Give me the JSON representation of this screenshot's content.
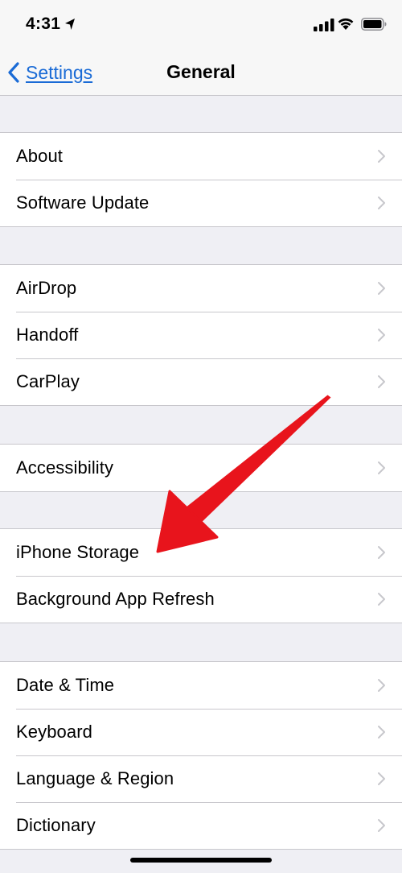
{
  "status_bar": {
    "time": "4:31"
  },
  "nav": {
    "back_label": "Settings",
    "title": "General"
  },
  "groups": [
    {
      "items": [
        "About",
        "Software Update"
      ]
    },
    {
      "items": [
        "AirDrop",
        "Handoff",
        "CarPlay"
      ]
    },
    {
      "items": [
        "Accessibility"
      ]
    },
    {
      "items": [
        "iPhone Storage",
        "Background App Refresh"
      ]
    },
    {
      "items": [
        "Date & Time",
        "Keyboard",
        "Language & Region",
        "Dictionary"
      ]
    }
  ],
  "icons": {
    "location": "location-arrow-icon",
    "signal": "cellular-signal-icon",
    "wifi": "wifi-icon",
    "battery": "battery-icon",
    "back": "chevron-left-icon",
    "disclosure": "chevron-right-icon"
  },
  "colors": {
    "accent": "#1a6bd6",
    "background": "#efeff4",
    "annotation_arrow": "#e8141c"
  }
}
